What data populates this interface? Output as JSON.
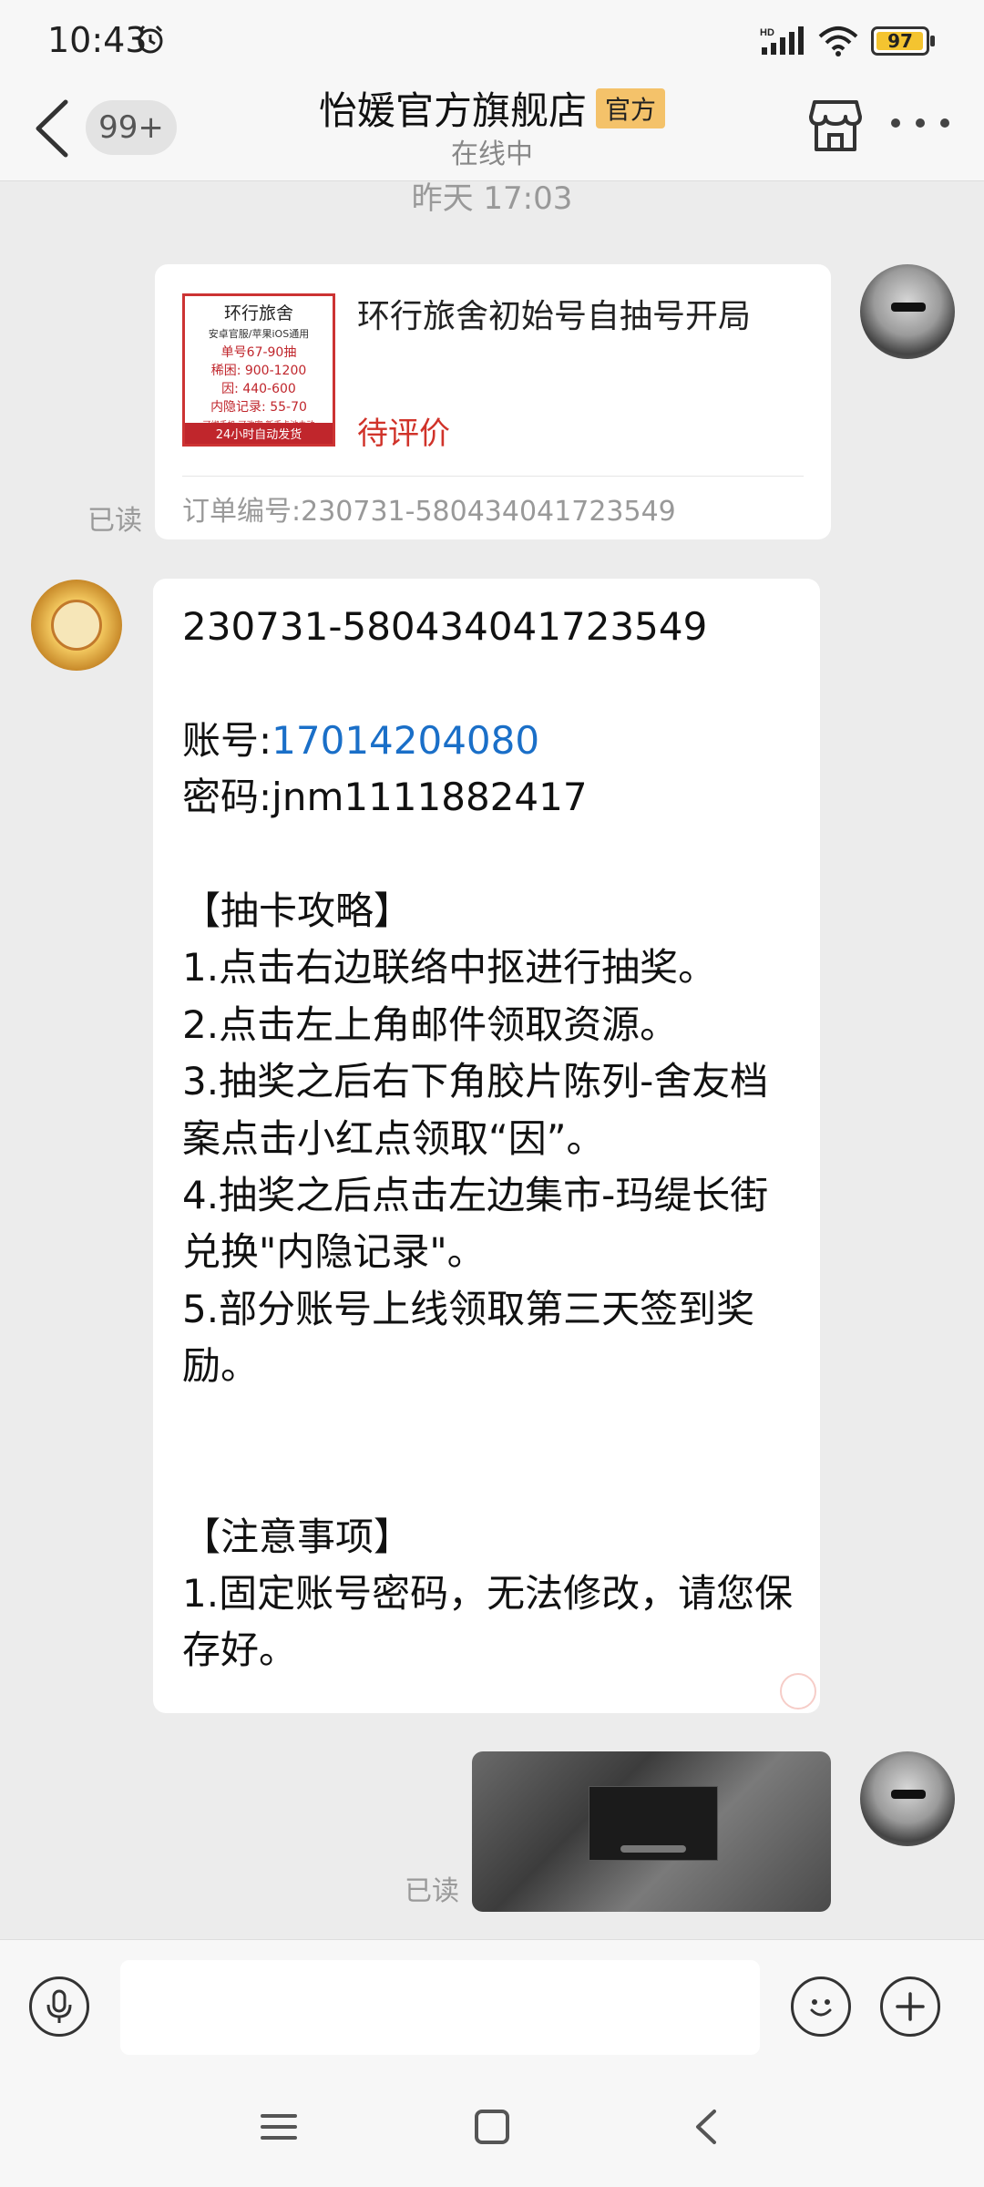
{
  "status_bar": {
    "time": "10:43",
    "network_label": "HD",
    "battery_level": "97"
  },
  "header": {
    "unread_badge": "99+",
    "shop_name": "怡媛官方旗舰店",
    "official_tag": "官方",
    "online_status": "在线中"
  },
  "chat": {
    "timestamp": "昨天 17:03",
    "order_card": {
      "thumbnail": {
        "line1": "环行旅舍",
        "line2": "安卓官服/苹果iOS通用",
        "line3": "单号67-90抽",
        "line4": "稀困: 900-1200",
        "line5": "因: 440-600",
        "line6": "内隐记录: 55-70",
        "line7": "可绑手机 可改密  新手卡池未动",
        "line8": "24小时自动发货"
      },
      "product_title": "环行旅舍初始号自抽号开局",
      "status": "待评价",
      "order_number": "订单编号:230731-580434041723549",
      "read_label": "已读"
    },
    "shop_message": {
      "line_order": "230731-580434041723549",
      "account_prefix": "账号:",
      "account_value": "17014204080",
      "password_line": "密码:jnm1111882417",
      "body": "【抽卡攻略】\n1.点击右边联络中抠进行抽奖。\n2.点击左上角邮件领取资源。\n3.抽奖之后右下角胶片陈列-舍友档案点击小红点领取“因”。\n4.抽奖之后点击左边集市-玛缇长街兑换\"内隐记录\"。\n5.部分账号上线领取第三天签到奖励。\n\n\n【注意事项】\n1.固定账号密码，无法修改，请您保存好。"
    },
    "image_message": {
      "read_label": "已读"
    }
  },
  "input_bar": {
    "voice_icon": "microphone-icon",
    "emoji_icon": "smiley-icon",
    "add_icon": "plus-icon"
  },
  "colors": {
    "accent_link": "#1a6fc8",
    "pending_red": "#d0332a",
    "official_tag_bg": "#f4c26a",
    "battery_fill": "#f4c430"
  }
}
